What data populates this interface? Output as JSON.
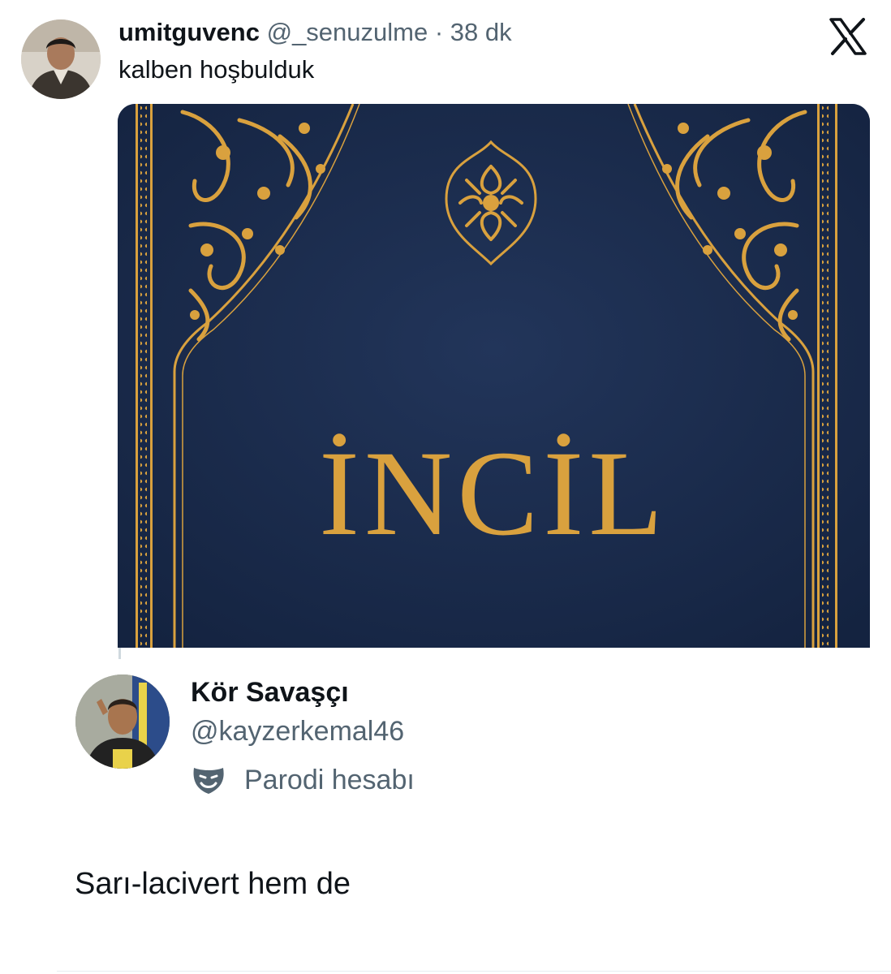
{
  "tweet": {
    "display_name": "umitguvenc",
    "handle": "@_senuzulme",
    "separator": "·",
    "time": "38 dk",
    "text": "kalben hoşbulduk",
    "avatar_icon": "user-avatar-icon",
    "platform_icon": "x-logo-icon"
  },
  "media": {
    "cover_title": "İNCİL",
    "cover_color": "#1c2c48",
    "ornament_color": "#d9a13e"
  },
  "reply": {
    "display_name": "Kör Savaşçı",
    "handle": "@kayzerkemal46",
    "badge_label": "Parodi hesabı",
    "badge_icon": "parody-mask-icon",
    "text": "Sarı-lacivert hem de"
  },
  "colors": {
    "text_primary": "#0f1419",
    "text_secondary": "#536471"
  }
}
